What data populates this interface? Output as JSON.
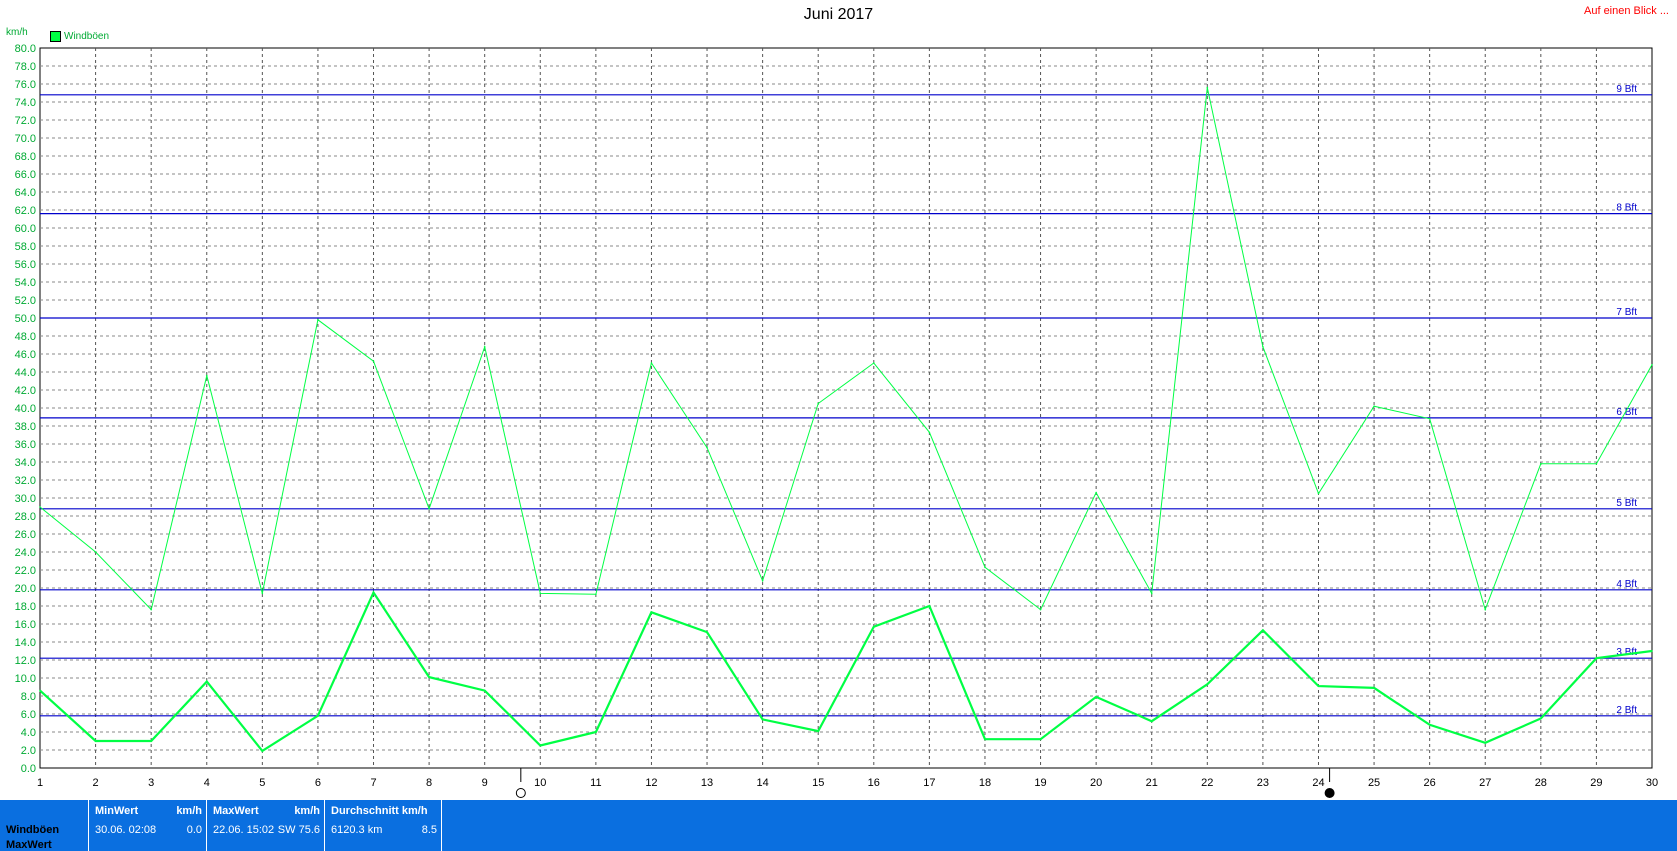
{
  "header": {
    "title": "Juni 2017",
    "link": "Auf einen Blick ...",
    "unit": "km/h"
  },
  "colors": {
    "series": "#00ff44",
    "beaufort": "#0000cc",
    "panel": "#0a6fe0"
  },
  "chart_data": {
    "type": "line",
    "title": "Juni 2017",
    "ylabel": "km/h",
    "ylim": [
      0,
      80
    ],
    "y_ticks": [
      "0.0",
      "2.0",
      "4.0",
      "6.0",
      "8.0",
      "10.0",
      "12.0",
      "14.0",
      "16.0",
      "18.0",
      "20.0",
      "22.0",
      "24.0",
      "26.0",
      "28.0",
      "30.0",
      "32.0",
      "34.0",
      "36.0",
      "38.0",
      "40.0",
      "42.0",
      "44.0",
      "46.0",
      "48.0",
      "50.0",
      "52.0",
      "54.0",
      "56.0",
      "58.0",
      "60.0",
      "62.0",
      "64.0",
      "66.0",
      "68.0",
      "70.0",
      "72.0",
      "74.0",
      "76.0",
      "78.0",
      "80.0"
    ],
    "x": [
      1,
      2,
      3,
      4,
      5,
      6,
      7,
      8,
      9,
      10,
      11,
      12,
      13,
      14,
      15,
      16,
      17,
      18,
      19,
      20,
      21,
      22,
      23,
      24,
      25,
      26,
      27,
      28,
      29,
      30
    ],
    "x_labels": [
      "1",
      "2",
      "3",
      "4",
      "5",
      "6",
      "7",
      "8",
      "9",
      "10",
      "11",
      "12",
      "13",
      "14",
      "15",
      "16",
      "17",
      "18",
      "19",
      "20",
      "21",
      "22",
      "23",
      "24",
      "25",
      "26",
      "27",
      "28",
      "29",
      "30"
    ],
    "grid": true,
    "legend": "top-left",
    "legend_label": "Windböen",
    "series": [
      {
        "role": "max",
        "values": [
          29.0,
          24.0,
          17.6,
          43.6,
          19.4,
          49.8,
          45.2,
          28.8,
          46.8,
          19.4,
          19.3,
          45.0,
          35.6,
          20.8,
          40.5,
          45.0,
          37.3,
          22.3,
          17.6,
          30.6,
          19.4,
          75.6,
          46.8,
          30.5,
          40.2,
          38.8,
          17.6,
          33.8,
          33.8,
          44.8
        ]
      },
      {
        "role": "avg",
        "values": [
          8.6,
          3.0,
          3.0,
          9.6,
          1.9,
          5.8,
          19.5,
          10.1,
          8.6,
          2.5,
          4.0,
          17.3,
          15.1,
          5.4,
          4.1,
          15.7,
          18.0,
          3.2,
          3.2,
          7.9,
          5.2,
          9.3,
          15.3,
          9.1,
          8.9,
          4.8,
          2.8,
          5.5,
          12.2,
          13.0
        ]
      }
    ],
    "beaufort": [
      {
        "label": "2 Bft",
        "value": 5.8
      },
      {
        "label": "3 Bft",
        "value": 12.2
      },
      {
        "label": "4 Bft",
        "value": 19.8
      },
      {
        "label": "5 Bft",
        "value": 28.8
      },
      {
        "label": "6 Bft",
        "value": 38.9
      },
      {
        "label": "7 Bft",
        "value": 50.0
      },
      {
        "label": "8 Bft",
        "value": 61.6
      },
      {
        "label": "9 Bft",
        "value": 74.8
      }
    ],
    "moon": [
      {
        "x": 9.65,
        "phase": "full-moon-icon"
      },
      {
        "x": 24.2,
        "phase": "new-moon-icon"
      }
    ]
  },
  "footer": {
    "row1": "Windböen",
    "row2": "MaxWert",
    "min": {
      "label": "MinWert",
      "unit": "km/h",
      "time": "30.06.  02:08",
      "value": "0.0"
    },
    "max": {
      "label": "MaxWert",
      "unit": "km/h",
      "time": "22.06.  15:02",
      "dir": "SW",
      "value": "75.6"
    },
    "avg": {
      "label": "Durchschnitt",
      "unit": "km/h",
      "dist": "6120.3 km",
      "value": "8.5"
    }
  }
}
